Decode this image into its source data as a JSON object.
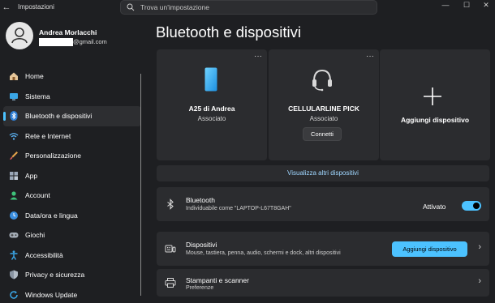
{
  "window": {
    "title": "Impostazioni",
    "back_glyph": "←",
    "controls": {
      "minimize": "—",
      "maximize": "☐",
      "close": "✕"
    }
  },
  "search": {
    "placeholder": "Trova un'impostazione"
  },
  "profile": {
    "name": "Andrea Morlacchi",
    "email_visible": "@gmail.com"
  },
  "sidebar": {
    "items": [
      {
        "label": "Home",
        "icon": "home-icon"
      },
      {
        "label": "Sistema",
        "icon": "display-icon"
      },
      {
        "label": "Bluetooth e dispositivi",
        "icon": "bluetooth-icon",
        "active": true
      },
      {
        "label": "Rete e Internet",
        "icon": "wifi-icon"
      },
      {
        "label": "Personalizzazione",
        "icon": "brush-icon"
      },
      {
        "label": "App",
        "icon": "apps-icon"
      },
      {
        "label": "Account",
        "icon": "account-icon"
      },
      {
        "label": "Data/ora e lingua",
        "icon": "globe-clock-icon"
      },
      {
        "label": "Giochi",
        "icon": "gamepad-icon"
      },
      {
        "label": "Accessibilità",
        "icon": "accessibility-icon"
      },
      {
        "label": "Privacy e sicurezza",
        "icon": "shield-icon"
      },
      {
        "label": "Windows Update",
        "icon": "update-icon"
      }
    ]
  },
  "main": {
    "title": "Bluetooth e dispositivi",
    "devices": [
      {
        "name": "A25 di Andrea",
        "status": "Associato",
        "icon": "phone-icon",
        "more": "···"
      },
      {
        "name": "CELLULARLINE PICK",
        "status": "Associato",
        "icon": "headset-icon",
        "more": "···",
        "button": "Connetti"
      }
    ],
    "add_device_card": {
      "label": "Aggiungi dispositivo",
      "icon": "plus-icon"
    },
    "show_more": "Visualizza altri dispositivi",
    "bluetooth": {
      "title": "Bluetooth",
      "subtitle": "Individuabile come \"LAPTOP-L67T8GAH\"",
      "toggle_label": "Attivato",
      "enabled": true
    },
    "devices_row": {
      "title": "Dispositivi",
      "subtitle": "Mouse, tastiera, penna, audio, schermi e dock, altri dispositivi",
      "button": "Aggiungi dispositivo",
      "chevron": "›"
    },
    "printers_row": {
      "title": "Stampanti e scanner",
      "subtitle": "Preferenze",
      "chevron": "›"
    }
  },
  "colors": {
    "accent": "#4cc2ff",
    "background": "#1e1f22",
    "card": "#2b2c2f"
  }
}
